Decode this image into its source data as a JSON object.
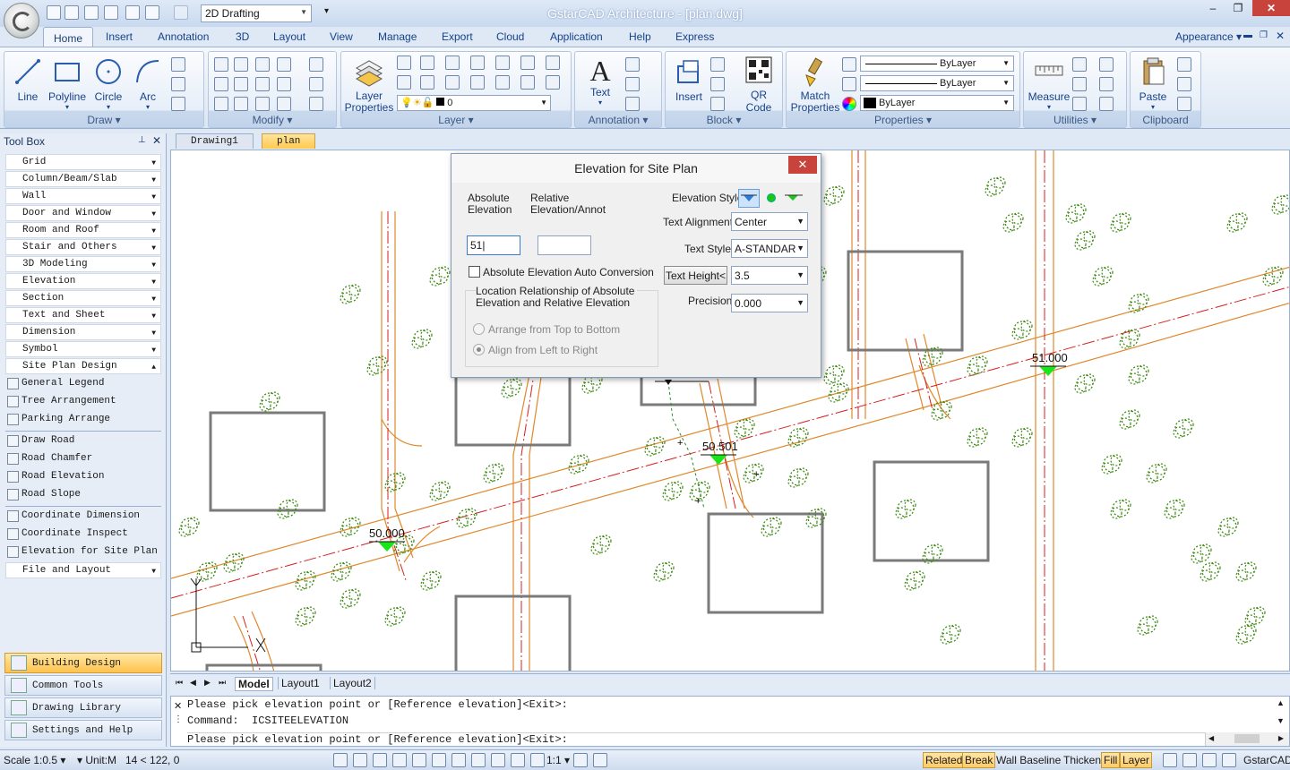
{
  "titlebar": {
    "workspace": "2D Drafting",
    "app_title": "GstarCAD Architecture - [plan.dwg]"
  },
  "tabs": [
    "Home",
    "Insert",
    "Annotation",
    "3D",
    "Layout",
    "View",
    "Manage",
    "Export",
    "Cloud",
    "Application",
    "Help",
    "Express"
  ],
  "appearance": "Appearance",
  "ribbon": {
    "draw": {
      "label": "Draw",
      "buttons": [
        "Line",
        "Polyline",
        "Circle",
        "Arc"
      ]
    },
    "modify": {
      "label": "Modify"
    },
    "layer": {
      "label": "Layer",
      "button": "Layer Properties",
      "current_layer": "0"
    },
    "annotation": {
      "label": "Annotation",
      "button": "Text"
    },
    "block": {
      "label": "Block",
      "insert": "Insert",
      "qr": "QR Code"
    },
    "properties": {
      "label": "Properties",
      "button": "Match Properties",
      "linetype1": "ByLayer",
      "linetype2": "ByLayer",
      "color": "ByLayer"
    },
    "utilities": {
      "label": "Utilities",
      "button": "Measure"
    },
    "clipboard": {
      "label": "Clipboard",
      "button": "Paste"
    }
  },
  "toolbox": {
    "title": "Tool Box",
    "items": [
      "Grid",
      "Column/Beam/Slab",
      "Wall",
      "Door and Window",
      "Room and Roof",
      "Stair and Others",
      "3D Modeling",
      "Elevation",
      "Section",
      "Text and Sheet",
      "Dimension",
      "Symbol",
      "Site Plan Design"
    ],
    "sub_group1": [
      "General Legend",
      "Tree Arrangement",
      "Parking Arrange"
    ],
    "sub_group2": [
      "Draw Road",
      "Road Chamfer",
      "Road Elevation",
      "Road Slope"
    ],
    "sub_group3": [
      "Coordinate Dimension",
      "Coordinate Inspect",
      "Elevation for Site Plan"
    ],
    "last_item": "File and Layout",
    "categories": [
      "Building Design",
      "Common Tools",
      "Drawing Library",
      "Settings and Help"
    ]
  },
  "doc_tabs": [
    "Drawing1",
    "plan"
  ],
  "layout_tabs": [
    "Model",
    "Layout1",
    "Layout2"
  ],
  "command": {
    "line1": "Please pick elevation point or [Reference elevation]<Exit>:",
    "line2": "Command:  ICSITEELEVATION",
    "line3": "Please pick elevation point or [Reference elevation]<Exit>:"
  },
  "status": {
    "scale": "Scale 1:0.5",
    "unit": "Unit:M",
    "coords": "14 < 122, 0",
    "anno_scale": "1:1",
    "buttons": [
      "Related",
      "Break",
      "Wall Baseline",
      "Thicken",
      "Fill",
      "Layer"
    ],
    "brand": "GstarCAD"
  },
  "drawing": {
    "elev1": "50.000",
    "elev2": "50.501",
    "elev3": "51.000"
  },
  "dialog": {
    "title": "Elevation for Site Plan",
    "abs_label": "Absolute Elevation",
    "rel_label": "Relative Elevation/Annota",
    "abs_value": "51",
    "rel_value": "",
    "auto_conv": "Absolute Elevation Auto Conversion",
    "loc_label": "Location Relationship of Absolute Elevation and Relative Elevation",
    "radio1": "Arrange from Top to Bottom",
    "radio2": "Align from Left to Right",
    "style_label": "Elevation Style:",
    "align_label": "Text Alignment:",
    "align_value": "Center",
    "tstyle_label": "Text Style:",
    "tstyle_value": "A-STANDAR",
    "height_btn": "Text Height<",
    "height_value": "3.5",
    "precision_label": "Precision:",
    "precision_value": "0.000",
    "colors": {
      "marker": "#19e619",
      "accent": "#ffc24d"
    }
  }
}
